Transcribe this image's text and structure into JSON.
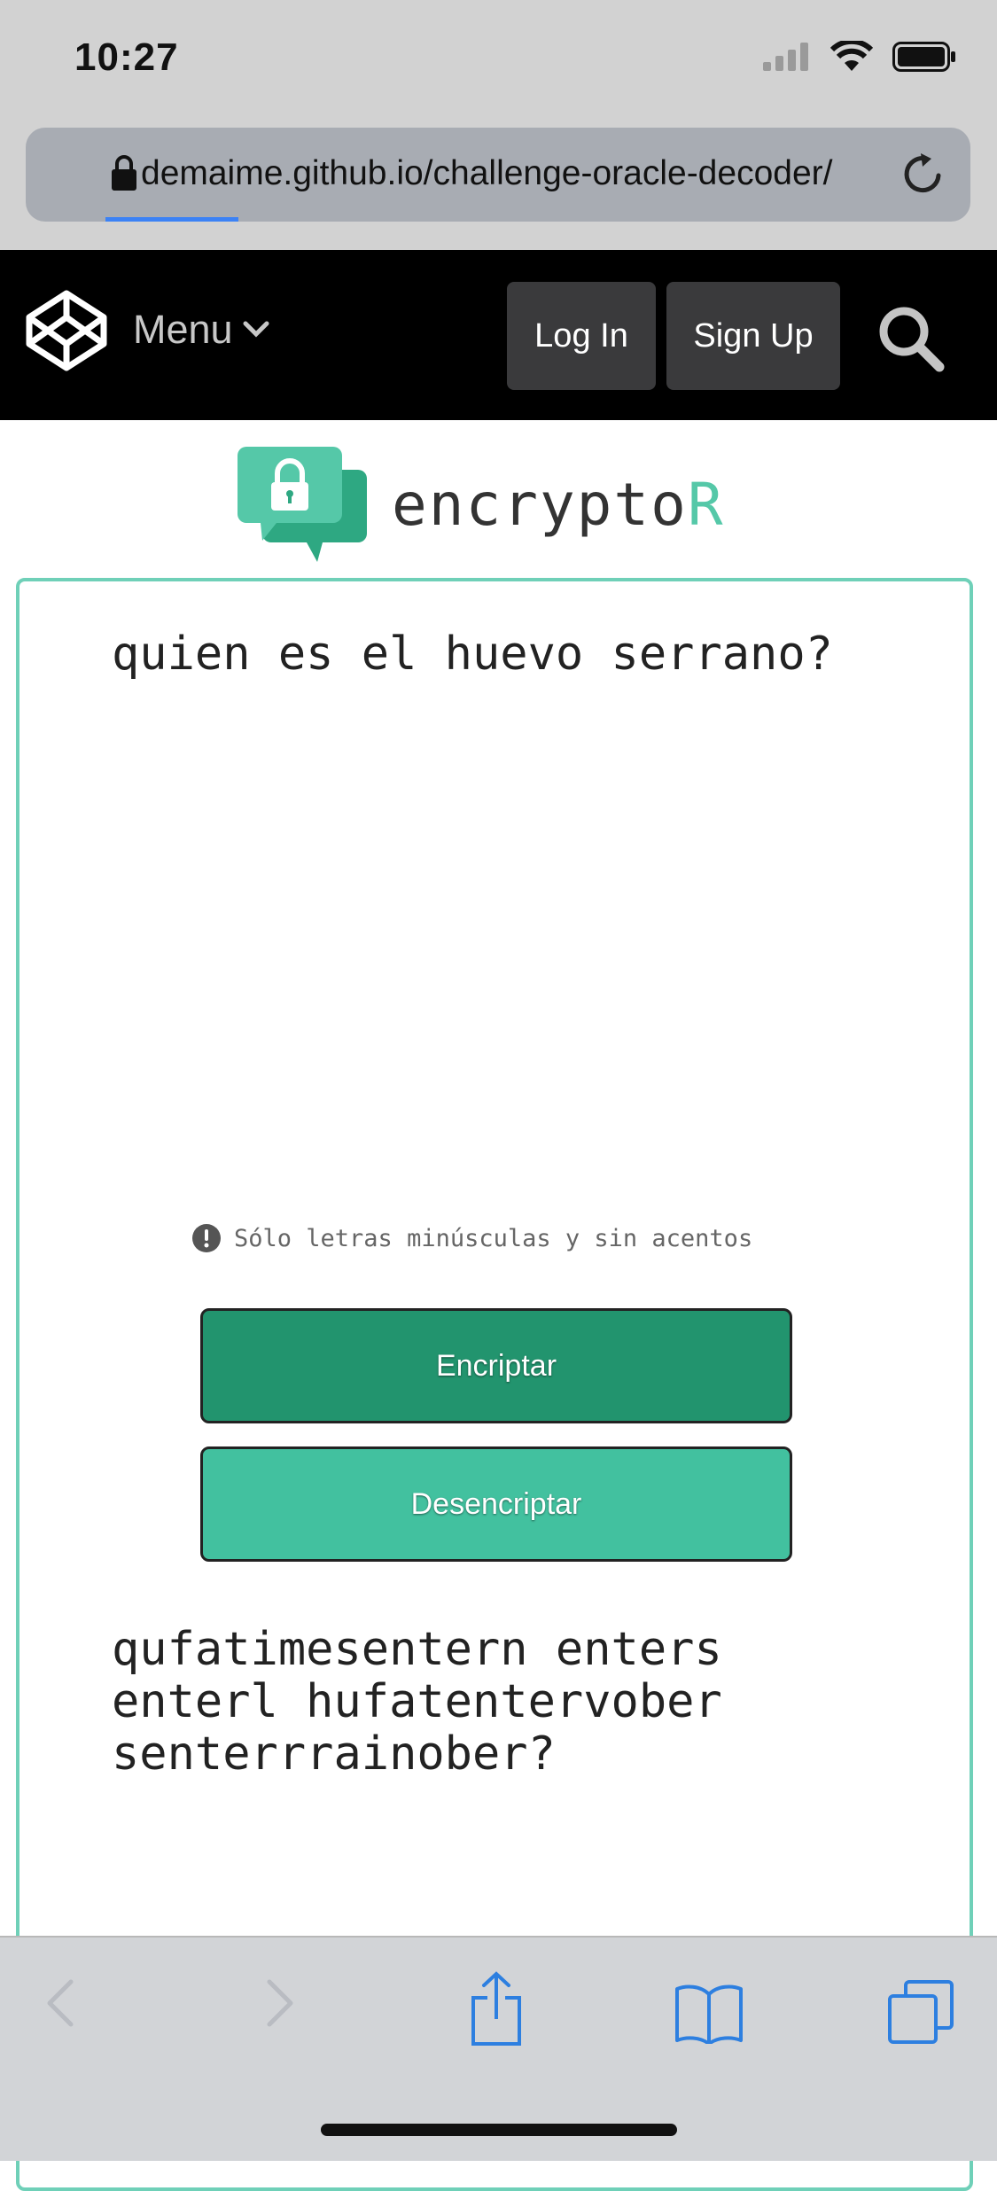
{
  "status_bar": {
    "time": "10:27"
  },
  "browser": {
    "url": "demaime.github.io/challenge-oracle-decoder/"
  },
  "codepen_header": {
    "menu_label": "Menu",
    "login_label": "Log In",
    "signup_label": "Sign Up"
  },
  "app": {
    "logo_text_main": "encrypto",
    "logo_text_accent": "R",
    "input_value": "quien es el huevo serrano?",
    "hint": "Sólo letras minúsculas y sin acentos",
    "encrypt_label": "Encriptar",
    "decrypt_label": "Desencriptar",
    "output_value": "qufatimesentern enters\nenterl hufatentervober\nsenterrrainober?"
  },
  "colors": {
    "accent": "#55c8a8",
    "encrypt_button": "#22946e",
    "decrypt_button": "#42c19f",
    "card_border": "#6fd0b8",
    "safari_blue": "#2d7fe0"
  }
}
